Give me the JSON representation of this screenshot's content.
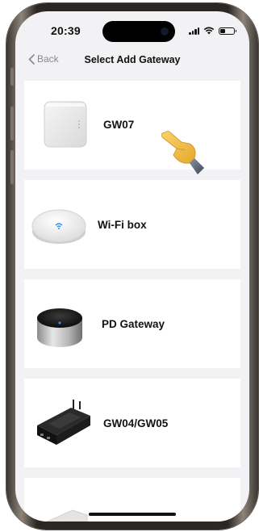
{
  "status_bar": {
    "time": "20:39"
  },
  "nav": {
    "back_label": "Back",
    "title": "Select Add Gateway"
  },
  "gateways": [
    {
      "label": "GW07",
      "icon": "gw07-device-icon"
    },
    {
      "label": "Wi-Fi box",
      "icon": "wifi-box-device-icon"
    },
    {
      "label": "PD Gateway",
      "icon": "pd-gateway-device-icon"
    },
    {
      "label": "GW04/GW05",
      "icon": "gw04-gw05-device-icon"
    },
    {
      "label": "",
      "icon": "partial-device-icon"
    }
  ],
  "colors": {
    "background": "#f2f2f4",
    "card": "#ffffff",
    "back": "#8a8a8e",
    "wifi_led": "#2a8cff"
  }
}
